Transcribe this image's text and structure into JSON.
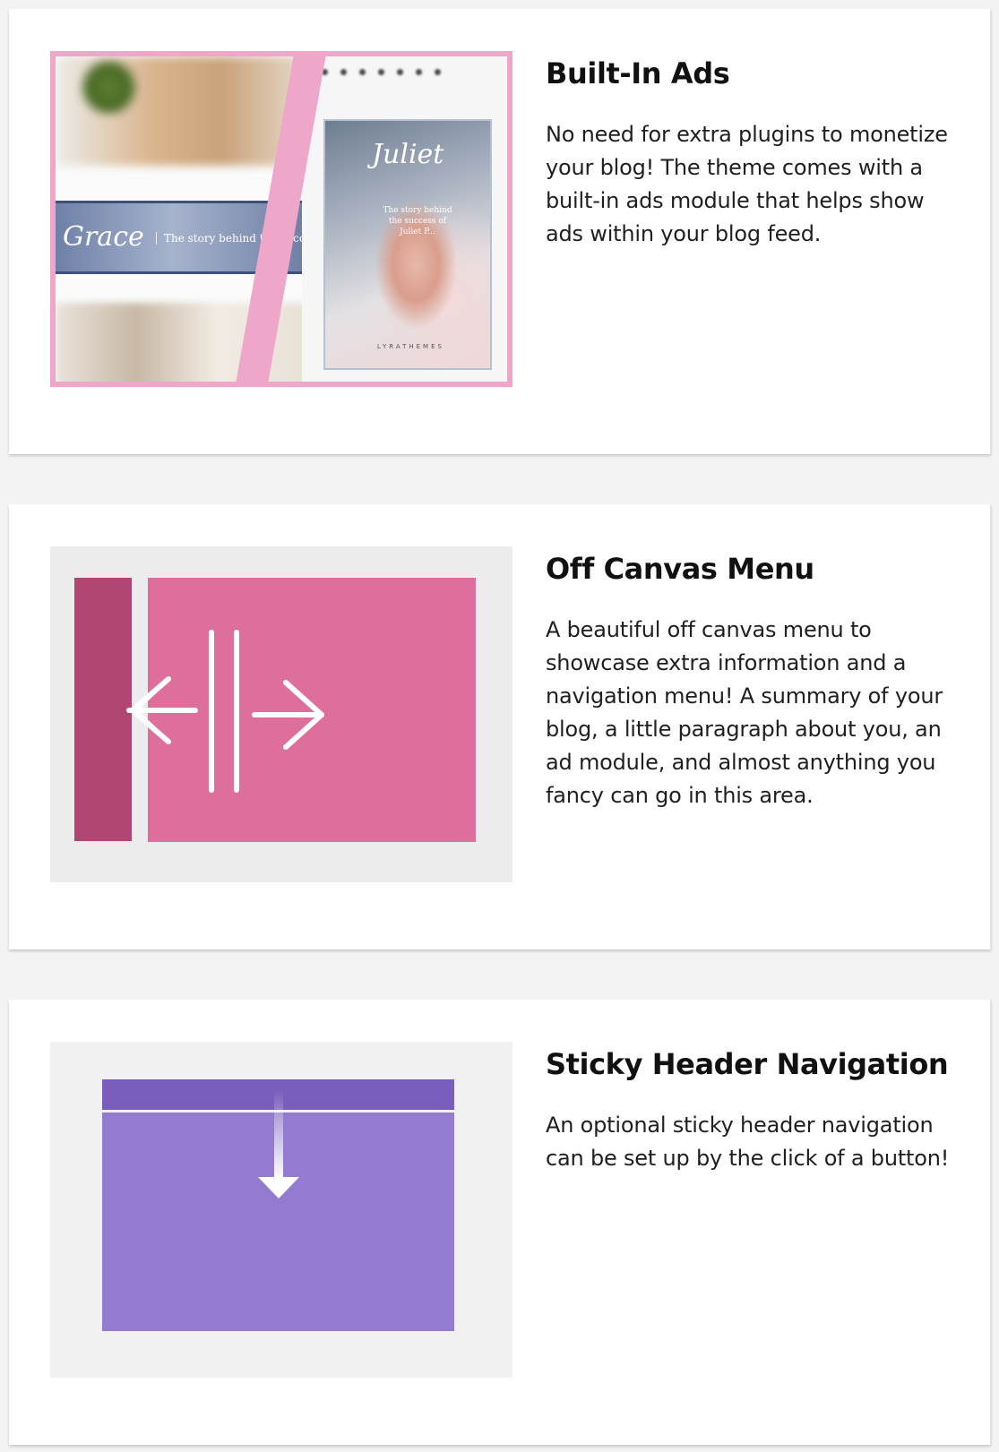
{
  "features": [
    {
      "title": "Built-In Ads",
      "description": "No need for extra plugins to monetize your blog! The theme comes with a built-in ads module that helps show ads within your blog feed.",
      "image": {
        "name_script_left": "Grace",
        "tagline_left": "The story behind the succ",
        "name_script_right": "Juliet",
        "tagline_right": "The story behind the success of Juliet P...",
        "brand": "LYRATHEMES",
        "frame_color": "#eea6c9"
      }
    },
    {
      "title": "Off Canvas Menu",
      "description": "A beautiful off canvas menu to showcase extra information and a navigation menu! A summary of your blog, a little paragraph about you, an ad module, and almost anything you fancy can go in this area.",
      "image": {
        "panel_color": "#b24672",
        "canvas_color": "#de6e9c"
      }
    },
    {
      "title": "Sticky Header Navigation",
      "description": "An optional sticky header navigation can be set up by the click of a button!",
      "image": {
        "header_color": "#7a5ebb",
        "screen_color": "#937ccf"
      }
    }
  ]
}
